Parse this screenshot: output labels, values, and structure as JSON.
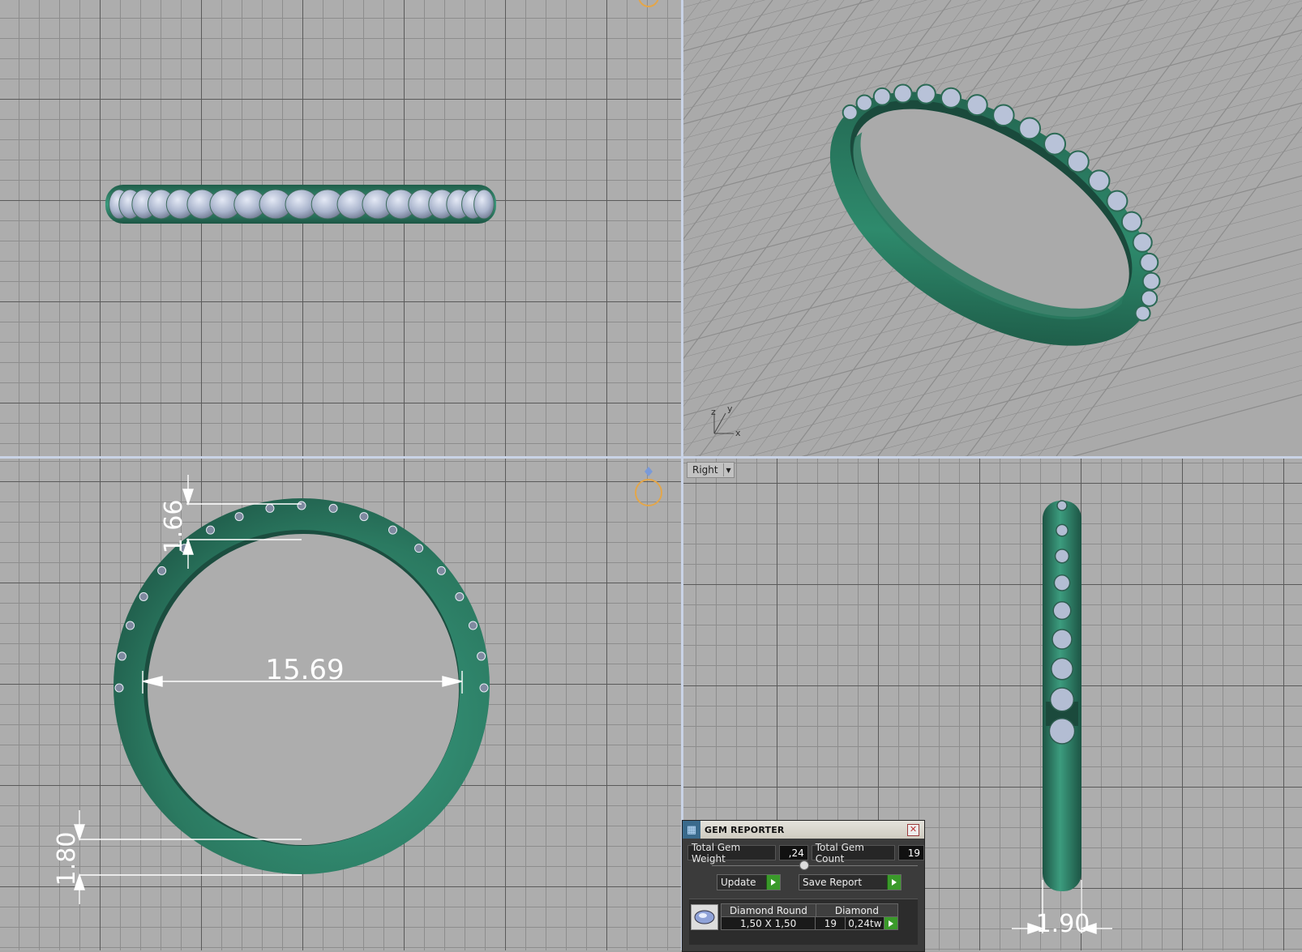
{
  "viewports": {
    "right_label": "Right",
    "front": {
      "dim_top": "1.66",
      "dim_width": "15.69",
      "dim_bottom": "1.80"
    },
    "right": {
      "dim_bottom": "1.90"
    },
    "perspective": {
      "axis_x": "x",
      "axis_y": "y",
      "axis_z": "z"
    }
  },
  "gem_reporter": {
    "title": "GEM REPORTER",
    "total_weight_label": "Total Gem Weight",
    "total_weight_value": ",24",
    "total_count_label": "Total Gem Count",
    "total_count_value": "19",
    "update_label": "Update",
    "save_label": "Save Report",
    "gem": {
      "name": "Diamond Round",
      "size": "1,50 X 1,50",
      "material": "Diamond",
      "count": "19",
      "weight": "0,24tw"
    }
  },
  "colors": {
    "metal": "#2f8067",
    "gem": "#aeb8d0",
    "grid_major": "#5a5a5a",
    "grid_minor": "#8d8d8d"
  }
}
